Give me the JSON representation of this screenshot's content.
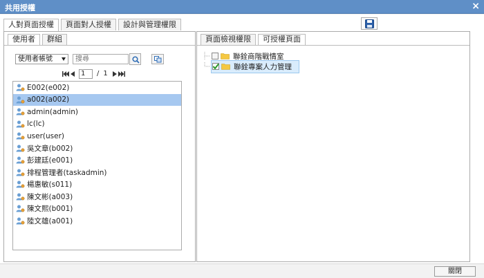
{
  "window": {
    "title": "共用授權"
  },
  "main_tabs": [
    {
      "label": "人對頁面授權",
      "active": true
    },
    {
      "label": "頁面對人授權",
      "active": false
    },
    {
      "label": "設計與管理權限",
      "active": false
    }
  ],
  "left": {
    "tabs": [
      {
        "label": "使用者",
        "active": true
      },
      {
        "label": "群組",
        "active": false
      }
    ],
    "filter_select": "使用者帳號",
    "search_placeholder": "搜尋",
    "pager": {
      "current": "1",
      "separator": "/",
      "total": "1"
    },
    "users": [
      {
        "label": "E002(e002)",
        "selected": false
      },
      {
        "label": "a002(a002)",
        "selected": true
      },
      {
        "label": "admin(admin)",
        "selected": false
      },
      {
        "label": "lc(lc)",
        "selected": false
      },
      {
        "label": "user(user)",
        "selected": false
      },
      {
        "label": "吳文章(b002)",
        "selected": false
      },
      {
        "label": "彭建廷(e001)",
        "selected": false
      },
      {
        "label": "排程管理者(taskadmin)",
        "selected": false
      },
      {
        "label": "楊惠敏(s011)",
        "selected": false
      },
      {
        "label": "陳文彬(a003)",
        "selected": false
      },
      {
        "label": "陳文熙(b001)",
        "selected": false
      },
      {
        "label": "陸文雄(a001)",
        "selected": false
      }
    ]
  },
  "right": {
    "tabs": [
      {
        "label": "頁面檢視權限",
        "active": false
      },
      {
        "label": "可授權頁面",
        "active": true
      }
    ],
    "tree": [
      {
        "label": "聯銓商階戰情室",
        "checked": false,
        "selected": false
      },
      {
        "label": "聯銓專案人力管理",
        "checked": true,
        "selected": true
      }
    ]
  },
  "footer": {
    "close_label": "關閉"
  },
  "colors": {
    "titlebar": "#5f8fc7",
    "selection": "#a6c8f0",
    "check": "#2a9a2a",
    "folder": "#f5c842"
  }
}
